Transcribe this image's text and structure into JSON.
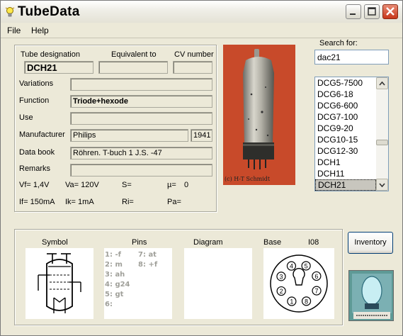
{
  "window": {
    "title": "TubeData"
  },
  "menu": {
    "file": "File",
    "help": "Help"
  },
  "tube": {
    "designation_label": "Tube designation",
    "equivalent_label": "Equivalent to",
    "cv_label": "CV number",
    "designation": "DCH21",
    "equivalent": "",
    "cv": "",
    "variations_label": "Variations",
    "variations": "",
    "function_label": "Function",
    "function": "Triode+hexode",
    "use_label": "Use",
    "use": "",
    "manufacturer_label": "Manufacturer",
    "manufacturer": "Philips",
    "year": "1941",
    "databook_label": "Data book",
    "databook": "Röhren. T-buch 1 J.S. -47",
    "remarks_label": "Remarks",
    "remarks": ""
  },
  "params": {
    "vf": "Vf= 1,4V",
    "va": "Va= 120V",
    "s": "S=",
    "mu_label": "µ=",
    "mu": "0",
    "if": "If= 150mA",
    "ik": "Ik= 1mA",
    "ri": "Ri=",
    "pa": "Pa="
  },
  "photo": {
    "credit": "(c) H-T Schmidt"
  },
  "search": {
    "label": "Search for:",
    "value": "dac21"
  },
  "list": {
    "items": [
      "DCG5-7500",
      "DCG6-18",
      "DCG6-600",
      "DCG7-100",
      "DCG9-20",
      "DCG10-15",
      "DCG12-30",
      "DCH1",
      "DCH11",
      "DCH21"
    ],
    "selected": "DCH21"
  },
  "bottom": {
    "symbol_label": "Symbol",
    "pins_label": "Pins",
    "diagram_label": "Diagram",
    "base_label": "Base",
    "base_type": "I08",
    "pins_left": [
      "1: -f",
      "2: m",
      "3: ah",
      "4: g24",
      "5: gt",
      "6:"
    ],
    "pins_right": [
      "7: at",
      "8: +f"
    ],
    "base_pins": [
      "1",
      "2",
      "3",
      "4",
      "5",
      "6",
      "7",
      "8"
    ]
  },
  "buttons": {
    "inventory": "Inventory"
  },
  "colors": {
    "photo_bg": "#c84a2a",
    "selection": "#c8c6be",
    "listbox_border": "#7f9db9",
    "close_button": "#c7371a"
  },
  "icons": {
    "app": "lightbulb-icon",
    "minimize": "minimize-icon",
    "maximize": "maximize-icon",
    "close": "close-icon"
  }
}
